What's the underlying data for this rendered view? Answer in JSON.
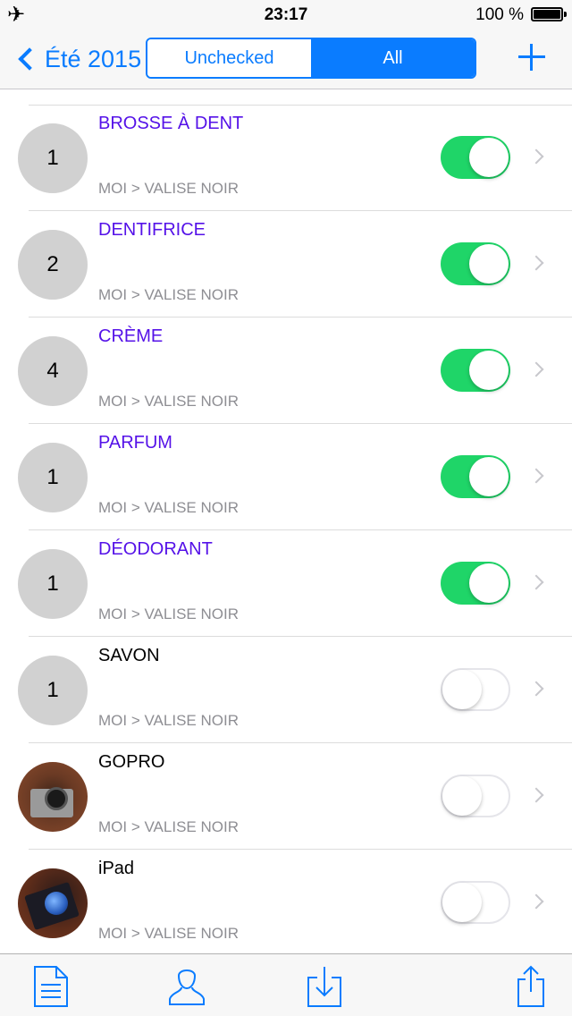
{
  "status_bar": {
    "time": "23:17",
    "battery": "100 %",
    "airplane_icon": "airplane-icon"
  },
  "nav": {
    "back_label": "Été 2015",
    "segments": [
      "Unchecked",
      "All"
    ],
    "selected_segment": "All",
    "add_icon": "plus-icon"
  },
  "colors": {
    "accent": "#0a7cff",
    "toggle_on": "#1fd568",
    "checked_title": "#5512e8",
    "subtitle": "#8e8e93"
  },
  "items": [
    {
      "count": "1",
      "title": "BROSSE À DENT",
      "path": "MOI > VALISE NOIR",
      "checked": true
    },
    {
      "count": "2",
      "title": "DENTIFRICE",
      "path": "MOI > VALISE NOIR",
      "checked": true
    },
    {
      "count": "4",
      "title": "CRÈME",
      "path": "MOI > VALISE NOIR",
      "checked": true
    },
    {
      "count": "1",
      "title": "PARFUM",
      "path": "MOI > VALISE NOIR",
      "checked": true
    },
    {
      "count": "1",
      "title": "DÉODORANT",
      "path": "MOI > VALISE NOIR",
      "checked": true
    },
    {
      "count": "1",
      "title": "SAVON",
      "path": "MOI > VALISE NOIR",
      "checked": false
    },
    {
      "count": "",
      "title": "GOPRO",
      "path": "MOI > VALISE NOIR",
      "checked": false
    },
    {
      "count": "",
      "title": "iPad",
      "path": "MOI > VALISE NOIR",
      "checked": false
    }
  ],
  "tab_bar": [
    "document-icon",
    "person-icon",
    "download-icon",
    "share-icon"
  ]
}
